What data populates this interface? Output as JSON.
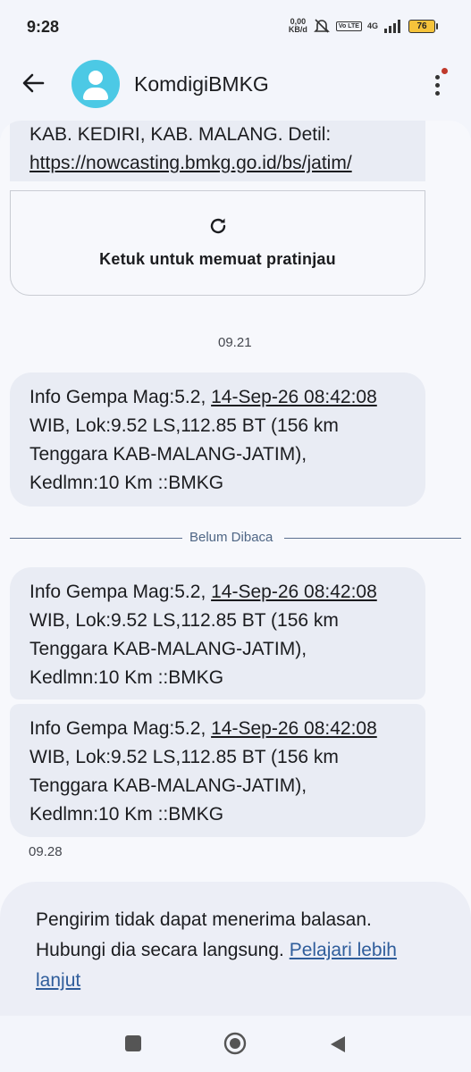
{
  "status_bar": {
    "time": "9:28",
    "net_speed_value": "0,00",
    "net_speed_unit": "KB/d",
    "volte_badge": "Vo LTE",
    "network": "4G",
    "battery": "76"
  },
  "header": {
    "contact_name": "KomdigiBMKG",
    "icons": [
      "back-arrow-icon",
      "avatar-person-icon",
      "more-vert-icon"
    ]
  },
  "messages": {
    "partial_top": {
      "line1": "KAB. KEDIRI, KAB. MALANG. Detil:",
      "link": "https://nowcasting.bmkg.go.id/bs/jatim/"
    },
    "link_preview": {
      "label": "Ketuk untuk memuat pratinjau",
      "icon": "refresh-icon"
    },
    "timestamp_1": "09.21",
    "unread_divider": "Belum Dibaca",
    "timestamp_2": "09.28",
    "quake_messages": [
      {
        "pre": "Info Gempa Mag:5.2, ",
        "date": "14-Sep-26 08:42:08",
        "line2": "WIB, Lok:9.52 LS,112.85 BT (156 km",
        "line3": "Tenggara KAB-MALANG-JATIM),",
        "line4": "Kedlmn:10 Km ::BMKG"
      },
      {
        "pre": "Info Gempa Mag:5.2, ",
        "date": "14-Sep-26 08:42:08",
        "line2": "WIB, Lok:9.52 LS,112.85 BT (156 km",
        "line3": "Tenggara KAB-MALANG-JATIM),",
        "line4": "Kedlmn:10 Km ::BMKG"
      },
      {
        "pre": "Info Gempa Mag:5.2, ",
        "date": "14-Sep-26 08:42:08",
        "line2": "WIB, Lok:9.52 LS,112.85 BT (156 km",
        "line3": "Tenggara KAB-MALANG-JATIM),",
        "line4": "Kedlmn:10 Km ::BMKG"
      }
    ]
  },
  "notice": {
    "text": "Pengirim tidak dapat menerima balasan. Hubungi dia secara langsung. ",
    "link": "Pelajari lebih lanjut"
  },
  "nav_bar": {
    "icons": [
      "recents-square-icon",
      "home-circle-icon",
      "back-triangle-icon"
    ]
  },
  "colors": {
    "avatar": "#4cc9e5",
    "bubble": "#e9ecf4",
    "link": "#2f5d9b",
    "battery": "#f5c33b",
    "notification_dot": "#c0392b"
  }
}
